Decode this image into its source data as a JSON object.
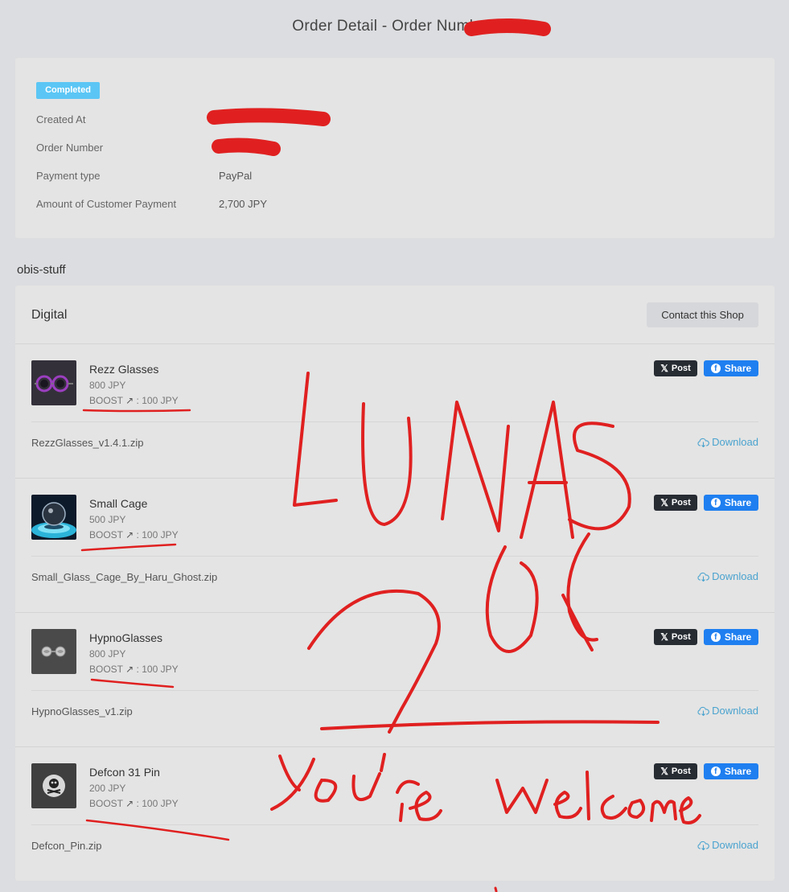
{
  "page": {
    "title": "Order Detail - Order Number:"
  },
  "order": {
    "status": "Completed",
    "fields": [
      {
        "label": "Created At",
        "value": ""
      },
      {
        "label": "Order Number",
        "value": ""
      },
      {
        "label": "Payment type",
        "value": "PayPal"
      },
      {
        "label": "Amount of Customer Payment",
        "value": "2,700 JPY"
      }
    ]
  },
  "shop": {
    "name": "obis-stuff",
    "section_title": "Digital",
    "contact_label": "Contact this Shop"
  },
  "products": [
    {
      "name": "Rezz Glasses",
      "price": "800 JPY",
      "boost_label": "BOOST",
      "boost_value": "100 JPY",
      "file": "RezzGlasses_v1.4.1.zip",
      "download_label": "Download",
      "post_label": "Post",
      "share_label": "Share"
    },
    {
      "name": "Small Cage",
      "price": "500 JPY",
      "boost_label": "BOOST",
      "boost_value": "100 JPY",
      "file": "Small_Glass_Cage_By_Haru_Ghost.zip",
      "download_label": "Download",
      "post_label": "Post",
      "share_label": "Share"
    },
    {
      "name": "HypnoGlasses",
      "price": "800 JPY",
      "boost_label": "BOOST",
      "boost_value": "100 JPY",
      "file": "HypnoGlasses_v1.zip",
      "download_label": "Download",
      "post_label": "Post",
      "share_label": "Share"
    },
    {
      "name": "Defcon 31 Pin",
      "price": "200 JPY",
      "boost_label": "BOOST",
      "boost_value": "100 JPY",
      "file": "Defcon_Pin.zip",
      "download_label": "Download",
      "post_label": "Post",
      "share_label": "Share"
    }
  ],
  "icons": {
    "x_logo": "x-logo-icon",
    "facebook": "facebook-icon",
    "download": "cloud-download-icon",
    "boost_arrow": "arrow-up-right-icon"
  },
  "colors": {
    "status_badge": "#5bc6f5",
    "facebook": "#1f7ff0",
    "x_post": "#272c33",
    "download_link": "#4aa3cf",
    "annotation": "#e02020"
  },
  "annotations": {
    "handwritten_text": [
      "LUNAS",
      "You",
      "you're welcome"
    ]
  }
}
